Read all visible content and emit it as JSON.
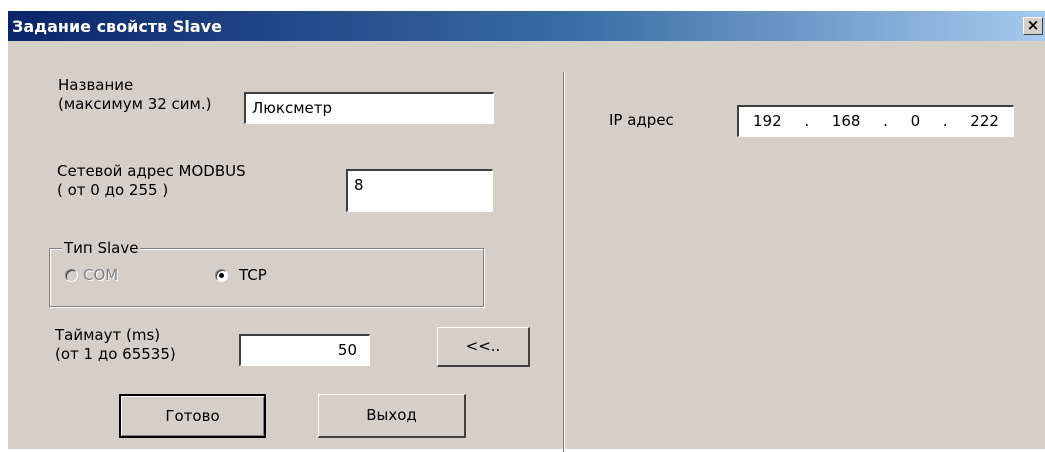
{
  "window": {
    "title": "Задание свойств Slave",
    "close_glyph": "×"
  },
  "name": {
    "label_line1": "Название",
    "label_line2": "(максимум 32 сим.)",
    "value": "Люксметр"
  },
  "modbus": {
    "label_line1": "Сетевой адрес MODBUS",
    "label_line2": "( от 0 до 255 )",
    "value": "8"
  },
  "slave_type": {
    "title": "Тип Slave",
    "options": [
      {
        "label": "COM",
        "selected": false,
        "enabled": false
      },
      {
        "label": "TCP",
        "selected": true,
        "enabled": true
      }
    ]
  },
  "timeout": {
    "label_line1": "Таймаут (ms)",
    "label_line2": "(от 1 до 65535)",
    "value": "50"
  },
  "buttons": {
    "collapse_label": "<<..",
    "ok_label": "Готово",
    "exit_label": "Выход"
  },
  "ip": {
    "label": "IP адрес",
    "octets": [
      "192",
      "168",
      "0",
      "222"
    ],
    "dot": "."
  }
}
